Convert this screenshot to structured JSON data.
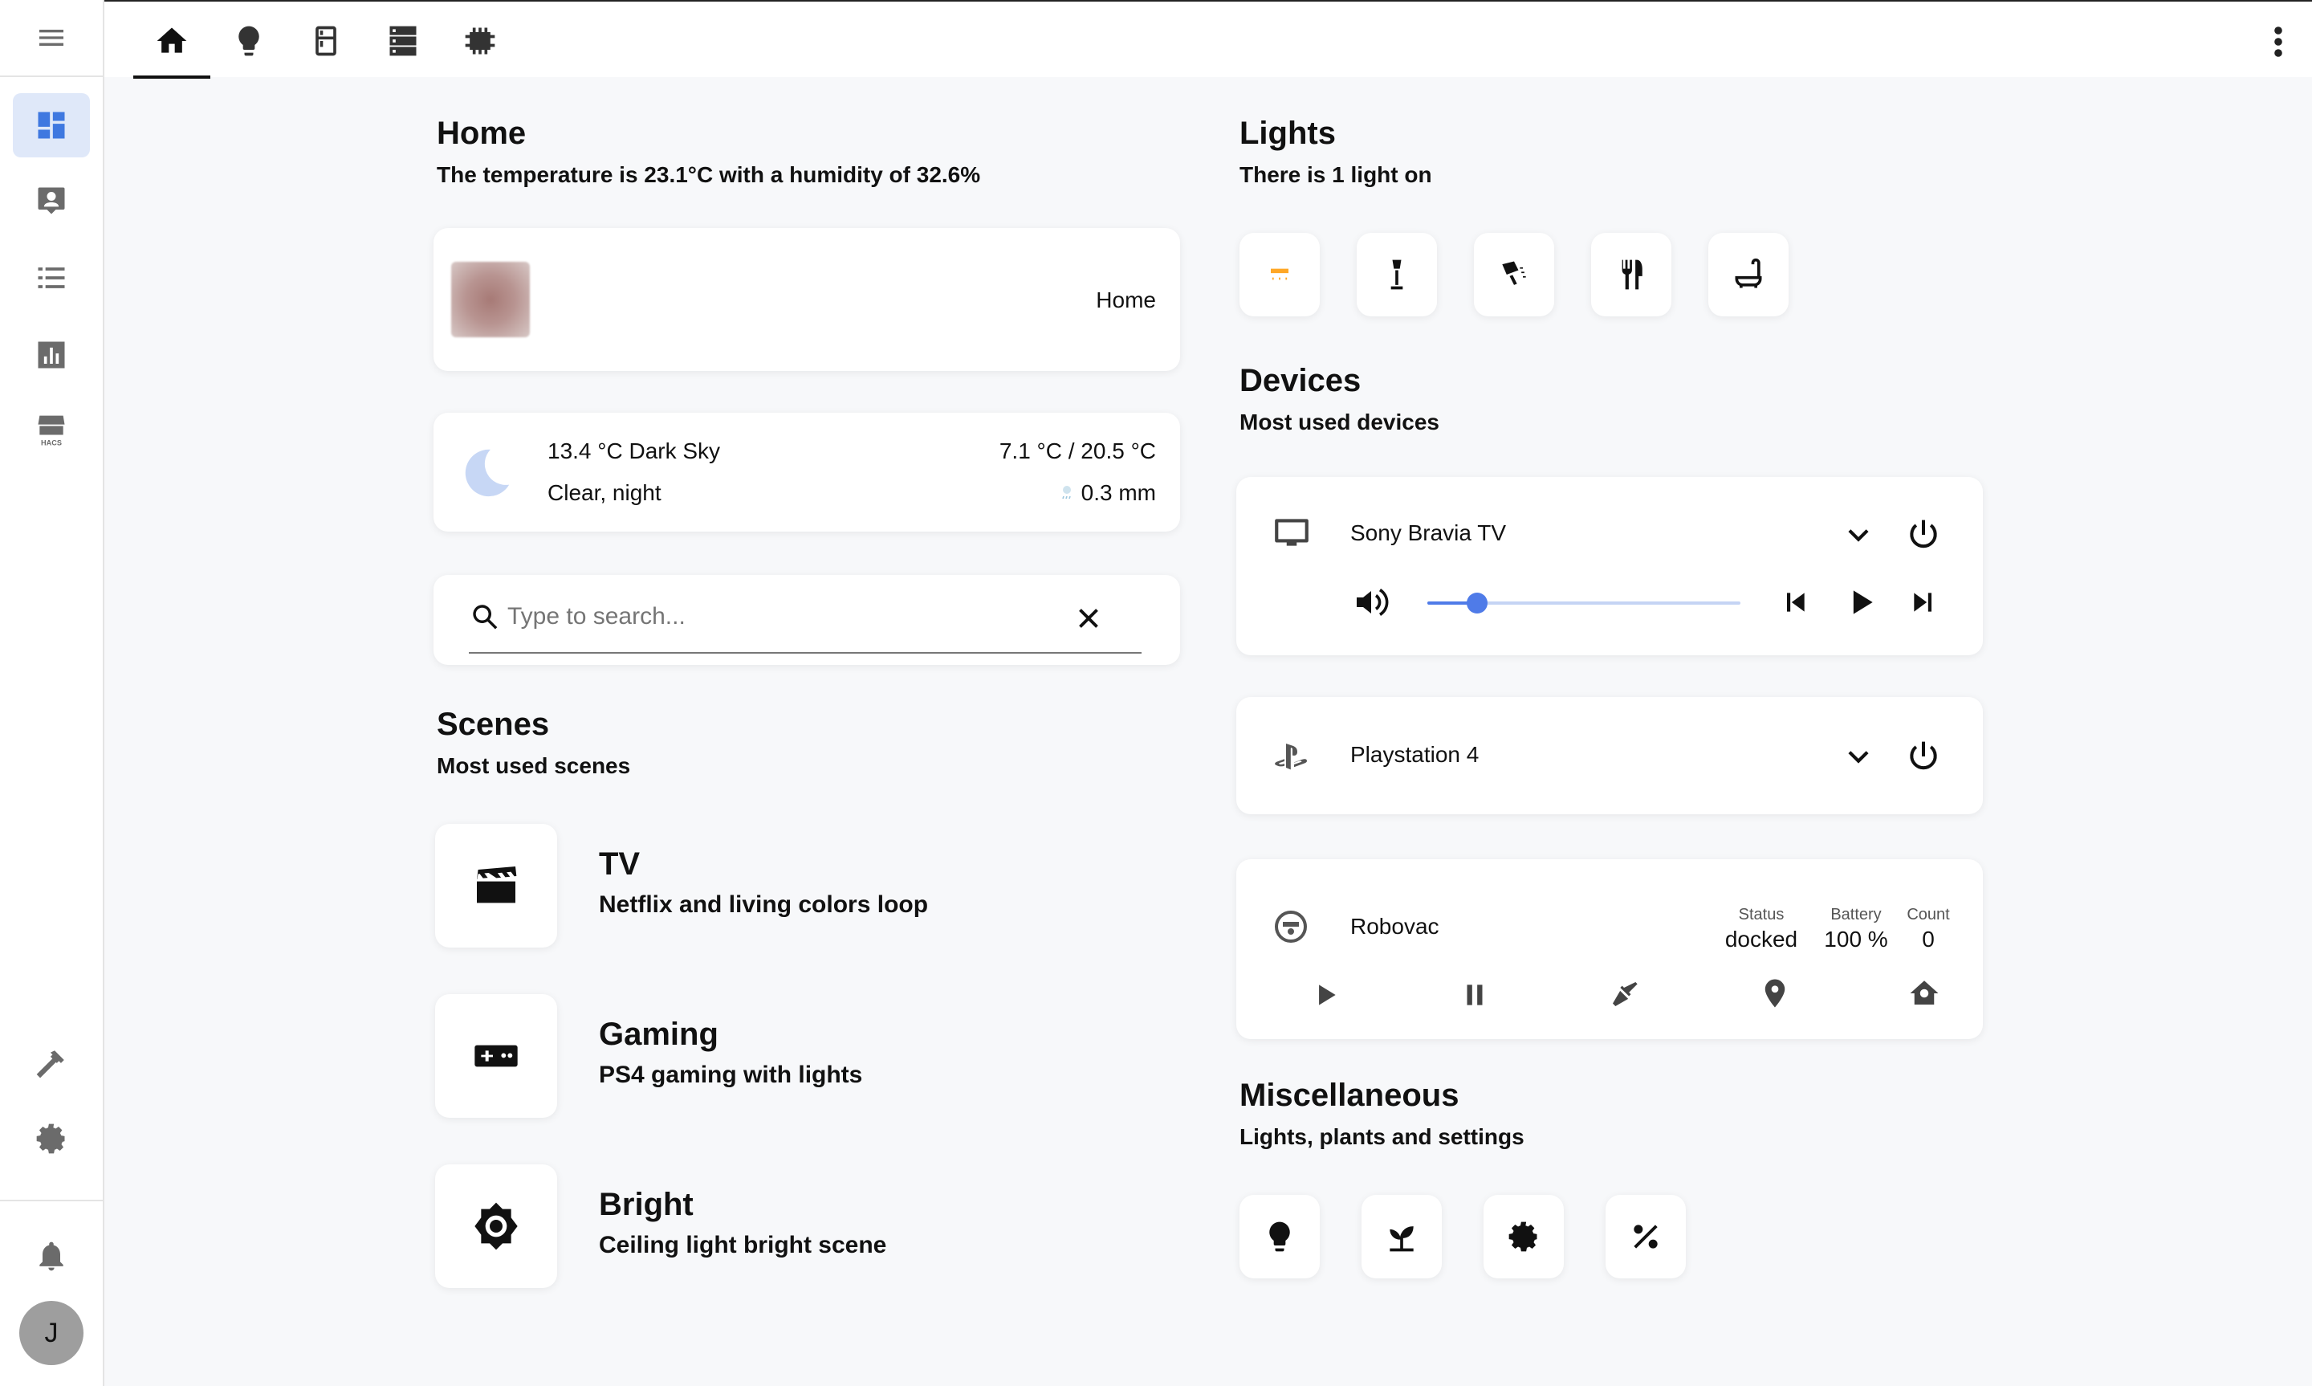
{
  "topbar": {
    "tabs": [
      {
        "icon": "home-icon",
        "active": true
      },
      {
        "icon": "lightbulb-icon"
      },
      {
        "icon": "fridge-icon"
      },
      {
        "icon": "server-icon"
      },
      {
        "icon": "memory-icon"
      }
    ]
  },
  "sidebar": {
    "items": [
      "dashboard-icon",
      "person-card-icon",
      "list-icon",
      "chart-icon",
      "hacs-icon"
    ],
    "hacs_label": "HACS",
    "bottom_items": [
      "hammer-icon",
      "settings-icon"
    ],
    "avatar_initial": "J"
  },
  "home": {
    "title": "Home",
    "subtitle": "The temperature is 23.1°C with a humidity of 32.6%",
    "person_state": "Home"
  },
  "weather": {
    "temp_desc": "13.4 °C Dark Sky",
    "condition": "Clear, night",
    "range": "7.1 °C / 20.5 °C",
    "precip": "0.3 mm"
  },
  "search": {
    "placeholder": "Type to search..."
  },
  "scenes": {
    "title": "Scenes",
    "subtitle": "Most used scenes",
    "items": [
      {
        "name": "TV",
        "desc": "Netflix and living colors loop",
        "icon": "clapperboard-icon"
      },
      {
        "name": "Gaming",
        "desc": "PS4 gaming with lights",
        "icon": "gamepad-icon"
      },
      {
        "name": "Bright",
        "desc": "Ceiling light bright scene",
        "icon": "brightness-icon"
      }
    ]
  },
  "lights": {
    "title": "Lights",
    "subtitle": "There is 1 light on",
    "accent": "#ffa726",
    "icons": [
      "ceiling-light-icon",
      "floor-lamp-icon",
      "desk-lamp-icon",
      "dining-icon",
      "bathtub-icon"
    ]
  },
  "devices": {
    "title": "Devices",
    "subtitle": "Most used devices",
    "tv": {
      "name": "Sony Bravia TV",
      "volume": 0.16
    },
    "ps4": {
      "name": "Playstation 4"
    },
    "robovac": {
      "name": "Robovac",
      "status_label": "Status",
      "status_value": "docked",
      "battery_label": "Battery",
      "battery_value": "100 %",
      "count_label": "Count",
      "count_value": "0"
    }
  },
  "misc": {
    "title": "Miscellaneous",
    "subtitle": "Lights, plants and settings",
    "icons": [
      "lightbulb-icon",
      "plant-icon",
      "settings-icon",
      "percent-icon"
    ]
  },
  "colors": {
    "accent_blue": "#4f7be8",
    "sidebar_active_bg": "#dfe8f9",
    "weather_moon": "#c7d7f5"
  }
}
